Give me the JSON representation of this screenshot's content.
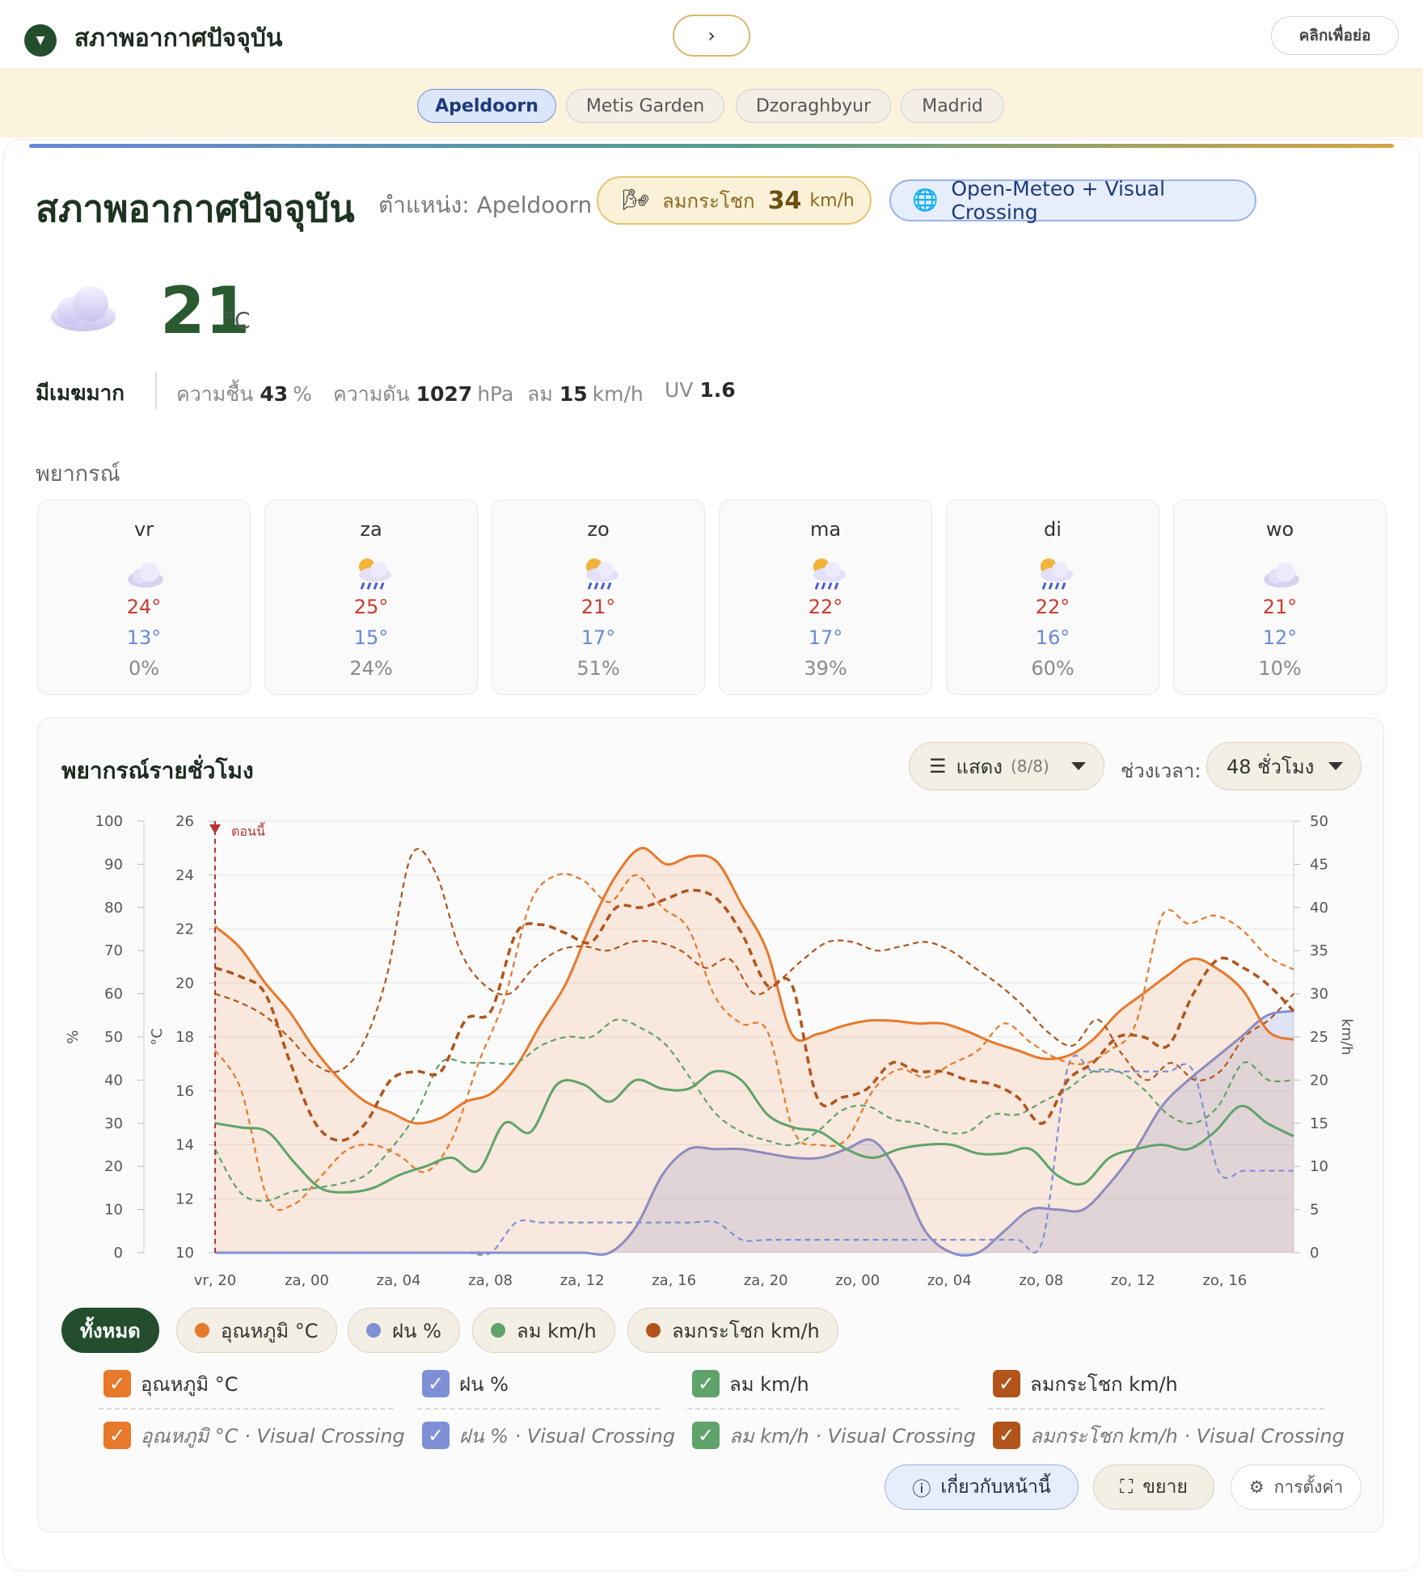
{
  "header": {
    "title": "สภาพอากาศปัจจุบัน",
    "next": "›",
    "minimize": "คลิกเพื่อย่อ"
  },
  "cities": [
    "Apeldoorn",
    "Metis Garden",
    "Dzoraghbyur",
    "Madrid"
  ],
  "current": {
    "title": "สภาพอากาศปัจจุบัน",
    "location": "ตำแหน่ง: Apeldoorn",
    "gust_label": "ลมกระโชก",
    "gust_value": "34",
    "gust_unit": "km/h",
    "source": "Open-Meteo + Visual Crossing",
    "temp": "21",
    "temp_unit": "°C",
    "condition": "มีเมฆมาก",
    "humidity_label": "ความชื้น",
    "humidity": "43",
    "humidity_unit": "%",
    "pressure_label": "ความดัน",
    "pressure": "1027",
    "pressure_unit": "hPa",
    "wind_label": "ลม",
    "wind": "15",
    "wind_unit": "km/h",
    "uv_label": "UV",
    "uv": "1.6"
  },
  "forecast": {
    "title": "พยากรณ์",
    "days": [
      {
        "day": "vr",
        "icon": "cloud-icon",
        "hi": "24°",
        "lo": "13°",
        "precip": "0%"
      },
      {
        "day": "za",
        "icon": "sun-rain-icon",
        "hi": "25°",
        "lo": "15°",
        "precip": "24%"
      },
      {
        "day": "zo",
        "icon": "sun-rain-icon",
        "hi": "21°",
        "lo": "17°",
        "precip": "51%"
      },
      {
        "day": "ma",
        "icon": "sun-rain-icon",
        "hi": "22°",
        "lo": "17°",
        "precip": "39%"
      },
      {
        "day": "di",
        "icon": "sun-rain-icon",
        "hi": "22°",
        "lo": "16°",
        "precip": "60%"
      },
      {
        "day": "wo",
        "icon": "cloud-icon",
        "hi": "21°",
        "lo": "12°",
        "precip": "10%"
      }
    ]
  },
  "hourly": {
    "title": "พยากรณ์รายชั่วโมง",
    "show_label": "แสดง",
    "show_count": "(8/8)",
    "range_label": "ช่วงเวลา:",
    "range_value": "48 ชั่วโมง"
  },
  "chart_data": {
    "type": "line",
    "now_label": "ตอนนี้",
    "x_ticks": [
      "vr, 20",
      "za, 00",
      "za, 04",
      "za, 08",
      "za, 12",
      "za, 16",
      "za, 20",
      "zo, 00",
      "zo, 04",
      "zo, 08",
      "zo, 12",
      "zo, 16"
    ],
    "x_range_hours": [
      0,
      47
    ],
    "axes": {
      "percent": {
        "label": "%",
        "range": [
          0,
          100
        ],
        "ticks": [
          0,
          10,
          20,
          30,
          40,
          50,
          60,
          70,
          80,
          90,
          100
        ]
      },
      "celsius": {
        "label": "°C",
        "range": [
          10,
          26
        ],
        "ticks": [
          10,
          12,
          14,
          16,
          18,
          20,
          22,
          24,
          26
        ]
      },
      "kmh": {
        "label": "km/h",
        "range": [
          0,
          50
        ],
        "ticks": [
          0,
          5,
          10,
          15,
          20,
          25,
          30,
          35,
          40,
          45,
          50
        ]
      }
    },
    "series": [
      {
        "name": "อุณหภูมิ °C",
        "axis": "celsius",
        "color": "#e8782a",
        "style": "solid",
        "fill": true,
        "values": [
          22.1,
          21.3,
          20.0,
          18.9,
          17.5,
          16.4,
          15.6,
          15.2,
          14.8,
          15.0,
          15.6,
          15.9,
          16.9,
          18.5,
          20.0,
          22.2,
          24.0,
          25.0,
          24.4,
          24.7,
          24.5,
          22.9,
          21.2,
          18.1,
          18.1,
          18.4,
          18.6,
          18.6,
          18.5,
          18.5,
          18.2,
          17.8,
          17.5,
          17.2,
          17.3,
          17.9,
          18.9,
          19.6,
          20.3,
          20.9,
          20.5,
          19.7,
          18.2,
          17.9
        ]
      },
      {
        "name": "ฝน %",
        "axis": "percent",
        "color": "#7f8fd6",
        "style": "solid",
        "fill": true,
        "values": [
          0,
          0,
          0,
          0,
          0,
          0,
          0,
          0,
          0,
          0,
          0,
          0,
          0,
          0,
          0,
          0,
          6,
          18,
          24,
          24,
          24,
          23,
          22,
          22,
          24,
          26,
          18,
          5,
          0,
          0,
          5,
          10,
          10,
          10,
          16,
          24,
          34,
          40,
          45,
          50,
          55,
          56
        ]
      },
      {
        "name": "ลม km/h",
        "axis": "kmh",
        "color": "#5fa36a",
        "style": "solid",
        "values": [
          15,
          14.5,
          14,
          10.5,
          7.5,
          7,
          7.5,
          9,
          10,
          11,
          9.5,
          15,
          14,
          19.5,
          19.5,
          17.5,
          20,
          19,
          19,
          21,
          20,
          16,
          14.5,
          14,
          12,
          11,
          12,
          12.5,
          12.5,
          11.5,
          11.5,
          12,
          9,
          8,
          11,
          12,
          12.5,
          12,
          14,
          17,
          15,
          13.5
        ]
      },
      {
        "name": "ลมกระโชก km/h",
        "axis": "kmh",
        "color": "#b2541a",
        "style": "dashed",
        "fill": false,
        "values": [
          33,
          32,
          30,
          22,
          15,
          13,
          15,
          20,
          21,
          21,
          27,
          28,
          37,
          38,
          37,
          36,
          40,
          40,
          41,
          42,
          41,
          37,
          31,
          31,
          18,
          18,
          19,
          22,
          21,
          21,
          20,
          19.5,
          18,
          15,
          20,
          22,
          25,
          25,
          24,
          30,
          34,
          33,
          31,
          28
        ]
      },
      {
        "name": "อุณหภูมิ °C · Visual Crossing",
        "axis": "celsius",
        "color": "#e8782a",
        "style": "dashed",
        "fill": false,
        "values": [
          17.5,
          16.0,
          12.0,
          11.8,
          12.8,
          13.8,
          14.0,
          13.6,
          13.0,
          14.2,
          17.0,
          19.4,
          23.0,
          24.0,
          23.8,
          23.0,
          24.0,
          22.8,
          22.0,
          19.5,
          18.5,
          18.2,
          14.5,
          14.0,
          14.2,
          16.0,
          16.8,
          16.5,
          17.0,
          17.5,
          18.5,
          17.8,
          17.2,
          17.0,
          17.5,
          18.5,
          22.5,
          22.2,
          22.5,
          22.0,
          21.0,
          20.5
        ]
      },
      {
        "name": "ฝน % · Visual Crossing",
        "axis": "percent",
        "color": "#7f8fd6",
        "style": "dashed",
        "fill": false,
        "values": [
          0,
          0,
          0,
          0,
          0,
          0,
          0,
          0,
          0,
          0,
          0,
          0,
          7,
          7,
          7,
          7,
          7,
          7,
          7,
          7,
          7,
          3,
          3,
          3,
          3,
          3,
          3,
          3,
          3,
          3,
          3,
          3,
          3,
          3,
          43,
          42,
          42,
          42,
          42,
          42,
          19,
          19,
          19,
          19
        ]
      },
      {
        "name": "ลม km/h · Visual Crossing",
        "axis": "kmh",
        "color": "#5fa36a",
        "style": "dashed",
        "fill": false,
        "values": [
          12,
          7,
          6,
          7,
          7.5,
          8,
          9,
          12,
          16,
          22,
          22,
          22,
          22,
          24,
          25,
          25,
          27,
          26,
          24,
          20,
          16,
          14,
          13,
          12.5,
          14,
          16.5,
          17,
          15.5,
          15,
          14,
          14,
          16,
          16,
          17.5,
          19,
          21,
          21,
          19,
          16,
          15,
          17,
          22,
          20,
          20
        ]
      },
      {
        "name": "ลมกระโชก km/h · Visual Crossing",
        "axis": "kmh",
        "color": "#b2541a",
        "style": "dashed",
        "fill": false,
        "values": [
          30,
          29,
          27.5,
          25,
          22,
          21,
          24,
          32,
          46,
          44,
          35,
          31,
          30,
          33,
          35,
          35.5,
          35,
          36,
          36,
          35,
          33,
          34,
          30,
          31.5,
          34,
          36,
          36,
          35,
          35.5,
          36,
          35,
          33,
          31,
          28.5,
          25.5,
          24,
          27,
          23,
          20,
          22,
          20,
          21,
          25,
          27,
          30
        ]
      }
    ]
  },
  "filters": {
    "chips": [
      {
        "label": "ทั้งหมด",
        "color": ""
      },
      {
        "label": "อุณหภูมิ °C",
        "color": "#e8782a"
      },
      {
        "label": "ฝน %",
        "color": "#7f8fd6"
      },
      {
        "label": "ลม km/h",
        "color": "#5fa36a"
      },
      {
        "label": "ลมกระโชก km/h",
        "color": "#b2541a"
      }
    ],
    "checks": [
      {
        "label": "อุณหภูมิ °C",
        "color": "#e8782a"
      },
      {
        "label": "ฝน %",
        "color": "#7f8fd6"
      },
      {
        "label": "ลม km/h",
        "color": "#5fa36a"
      },
      {
        "label": "ลมกระโชก km/h",
        "color": "#b2541a"
      }
    ],
    "checks_vc": [
      {
        "label": "อุณหภูมิ °C · Visual Crossing",
        "color": "#e8782a"
      },
      {
        "label": "ฝน % · Visual Crossing",
        "color": "#7f8fd6"
      },
      {
        "label": "ลม km/h · Visual Crossing",
        "color": "#5fa36a"
      },
      {
        "label": "ลมกระโชก km/h · Visual Crossing",
        "color": "#b2541a"
      }
    ],
    "check_mark": "✓"
  },
  "footer": {
    "about": "เกี่ยวกับหน้านี้",
    "expand": "ขยาย",
    "settings": "การตั้งค่า"
  }
}
